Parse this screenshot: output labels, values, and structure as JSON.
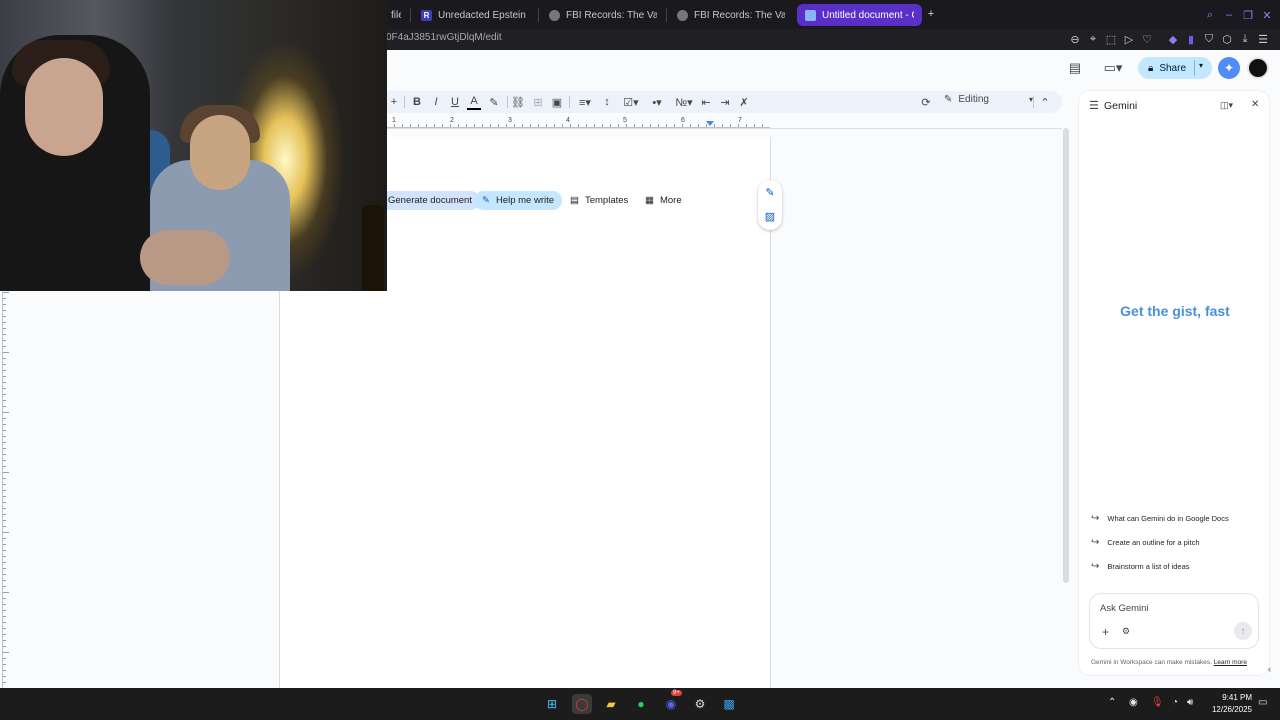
{
  "browser": {
    "tabs": [
      {
        "label": "file",
        "active": false
      },
      {
        "label": "Unredacted Epstein Files",
        "active": false,
        "favicon": "R"
      },
      {
        "label": "FBI Records: The Vault —",
        "active": false
      },
      {
        "label": "FBI Records: The Vault —",
        "active": false
      },
      {
        "label": "Untitled document - Goog",
        "active": true
      }
    ],
    "new_tab": "+",
    "url": "0F4aJ3851rwGtjDlqM/edit"
  },
  "docs": {
    "share_label": "Share",
    "editing_label": "Editing",
    "ruler_numbers": [
      "1",
      "2",
      "3",
      "4",
      "5",
      "6",
      "7"
    ],
    "chips": {
      "generate": "Generate document",
      "help": "Help me write",
      "templates": "Templates",
      "more": "More"
    }
  },
  "gemini": {
    "title": "Gemini",
    "hero": "Get the gist, fast",
    "suggestions": [
      "What can Gemini do in Google Docs",
      "Create an outline for a pitch",
      "Brainstorm a list of ideas"
    ],
    "input_placeholder": "Ask Gemini",
    "disclaimer": "Gemini in Workspace can make mistakes.",
    "learn_more": "Learn more"
  },
  "taskbar": {
    "time": "9:41 PM",
    "date": "12/26/2025",
    "discord_badge": "9+"
  },
  "colors": {
    "active_tab": "#5a2fc7",
    "share_bg": "#c2e7ff",
    "hero_text": "#4a90d9",
    "help_chip": "#c2e7ff"
  }
}
